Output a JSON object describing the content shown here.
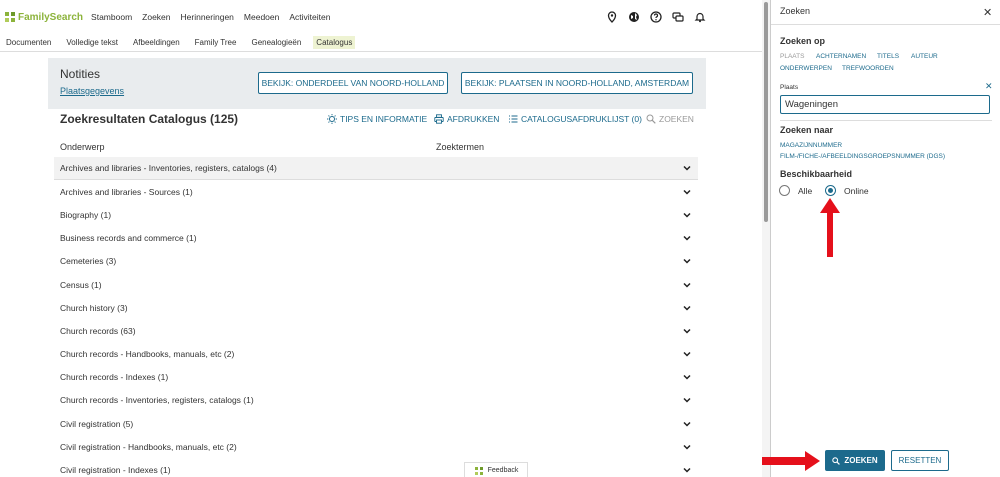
{
  "header": {
    "logo_text": "FamilySearch",
    "nav": [
      "Stamboom",
      "Zoeken",
      "Herinneringen",
      "Meedoen",
      "Activiteiten"
    ],
    "icons": [
      "location-icon",
      "globe-icon",
      "help-icon",
      "messages-icon",
      "bell-icon"
    ]
  },
  "subnav": {
    "items": [
      "Documenten",
      "Volledige tekst",
      "Afbeeldingen",
      "Family Tree",
      "Genealogieën",
      "Catalogus"
    ],
    "active": "Catalogus"
  },
  "notes": {
    "title": "Notities",
    "link": "Plaatsgegevens",
    "button1": "BEKIJK: ONDERDEEL VAN NOORD-HOLLAND",
    "button2": "BEKIJK: PLAATSEN IN NOORD-HOLLAND, AMSTERDAM"
  },
  "results": {
    "title": "Zoekresultaten Catalogus (125)",
    "tips": "TIPS EN INFORMATIE",
    "print": "AFDRUKKEN",
    "printlist": "CATALOGUSAFDRUKLIJST (0)",
    "search": "ZOEKEN",
    "col_subject": "Onderwerp",
    "col_terms": "Zoektermen",
    "rows": [
      "Archives and libraries - Inventories, registers, catalogs (4)",
      "Archives and libraries - Sources (1)",
      "Biography (1)",
      "Business records and commerce (1)",
      "Cemeteries (3)",
      "Census (1)",
      "Church history (3)",
      "Church records (63)",
      "Church records - Handbooks, manuals, etc (2)",
      "Church records - Indexes (1)",
      "Church records - Inventories, registers, catalogs (1)",
      "Civil registration (5)",
      "Civil registration - Handbooks, manuals, etc (2)",
      "Civil registration - Indexes (1)"
    ]
  },
  "feedback": "Feedback",
  "panel": {
    "title": "Zoeken",
    "search_on_label": "Zoeken op",
    "tabs": [
      "PLAATS",
      "ACHTERNAMEN",
      "TITELS",
      "AUTEUR",
      "ONDERWERPEN",
      "TREFWOORDEN"
    ],
    "field_label": "Plaats",
    "field_value": "Wageningen",
    "search_for_label": "Zoeken naar",
    "search_for_links": [
      "MAGAZIJNNUMMER",
      "FILM-/FICHE-/AFBEELDINGSGROEPSNUMMER (DGS)"
    ],
    "availability_label": "Beschikbaarheid",
    "option_all": "Alle",
    "option_online": "Online",
    "selected": "Online",
    "search_button": "ZOEKEN",
    "reset_button": "RESETTEN"
  },
  "colors": {
    "accent": "#1c6a8c",
    "logo": "#8cb33b",
    "arrow": "#e5101b"
  }
}
